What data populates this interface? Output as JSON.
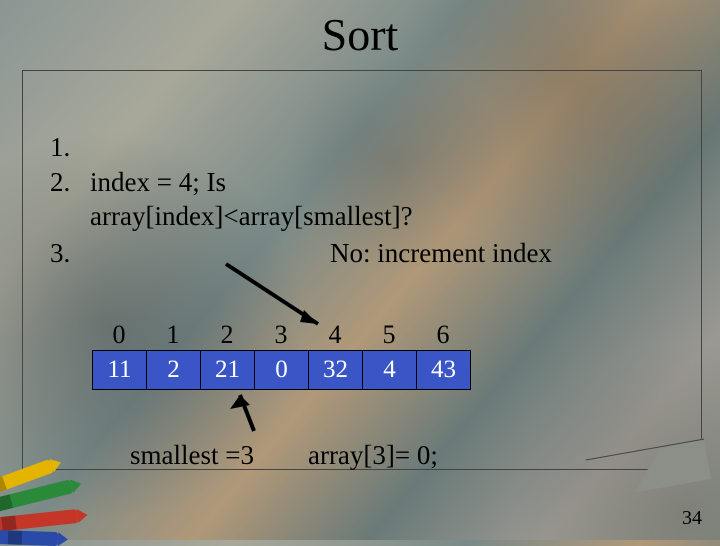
{
  "title": "Sort",
  "steps": {
    "s1": {
      "num": "1."
    },
    "s2": {
      "num": "2.",
      "line1": "index = 4; Is",
      "line2": "array[index]<array[smallest]?"
    },
    "s3": {
      "num": "3.",
      "text": "No: increment index"
    }
  },
  "array": {
    "indices": [
      "0",
      "1",
      "2",
      "3",
      "4",
      "5",
      "6"
    ],
    "values": [
      "11",
      "2",
      "21",
      "0",
      "32",
      "4",
      "43"
    ]
  },
  "bottom": {
    "smallest": "smallest =3",
    "array_at": "array[3]= 0;"
  },
  "slide_number": "34"
}
